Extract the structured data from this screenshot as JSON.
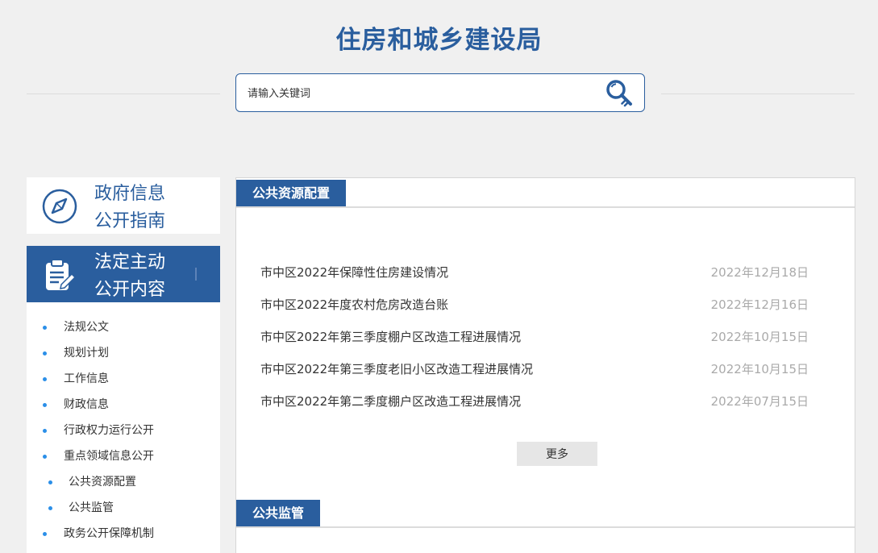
{
  "site": {
    "title": "住房和城乡建设局"
  },
  "search": {
    "placeholder": "请输入关键词",
    "icon": "search-key-icon"
  },
  "sidebar": {
    "guide_card": {
      "label_line1": "政府信息",
      "label_line2": "公开指南",
      "icon": "compass-icon"
    },
    "active_card": {
      "label_line1": "法定主动",
      "label_line2": "公开内容",
      "icon": "clipboard-edit-icon"
    },
    "menu": [
      {
        "label": "法规公文"
      },
      {
        "label": "规划计划"
      },
      {
        "label": "工作信息"
      },
      {
        "label": "财政信息"
      },
      {
        "label": "行政权力运行公开"
      },
      {
        "label": "重点领域信息公开"
      },
      {
        "label": "公共资源配置"
      },
      {
        "label": "公共监管"
      },
      {
        "label": "政务公开保障机制"
      }
    ]
  },
  "main": {
    "sections": [
      {
        "title": "公共资源配置",
        "items": [
          {
            "title": "市中区2022年保障性住房建设情况",
            "date": "2022年12月18日"
          },
          {
            "title": "市中区2022年度农村危房改造台账",
            "date": "2022年12月16日"
          },
          {
            "title": "市中区2022年第三季度棚户区改造工程进展情况",
            "date": "2022年10月15日"
          },
          {
            "title": "市中区2022年第三季度老旧小区改造工程进展情况",
            "date": "2022年10月15日"
          },
          {
            "title": "市中区2022年第二季度棚户区改造工程进展情况",
            "date": "2022年07月15日"
          }
        ],
        "more_label": "更多"
      },
      {
        "title": "公共监管"
      }
    ]
  },
  "colors": {
    "brand": "#2a5e9e",
    "bullet": "#2b8fe8",
    "background": "#f0f0f0"
  }
}
